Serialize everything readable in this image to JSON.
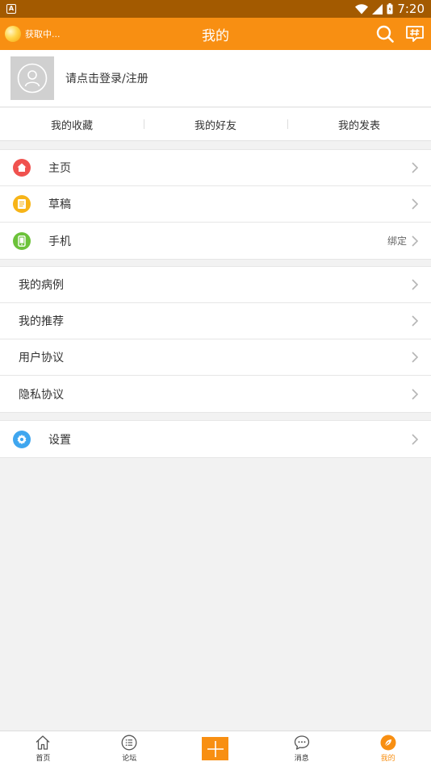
{
  "status_bar": {
    "app_badge": "A",
    "time": "7:20"
  },
  "header": {
    "weather_text": "获取中...",
    "title": "我的"
  },
  "profile": {
    "login_text": "请点击登录/注册"
  },
  "quick_links": [
    {
      "label": "我的收藏"
    },
    {
      "label": "我的好友"
    },
    {
      "label": "我的发表"
    }
  ],
  "menu_primary": [
    {
      "label": "主页",
      "icon": "home-icon",
      "color": "#f0524f"
    },
    {
      "label": "草稿",
      "icon": "draft-icon",
      "color": "#f7b418"
    },
    {
      "label": "手机",
      "icon": "phone-icon",
      "color": "#6cc23a",
      "extra": "绑定"
    }
  ],
  "menu_secondary": [
    {
      "label": "我的病例"
    },
    {
      "label": "我的推荐"
    },
    {
      "label": "用户协议"
    },
    {
      "label": "隐私协议"
    }
  ],
  "menu_settings": [
    {
      "label": "设置",
      "icon": "gear-icon",
      "color": "#3fa6ef"
    }
  ],
  "tab_bar": [
    {
      "label": "首页",
      "icon": "home-outline-icon"
    },
    {
      "label": "论坛",
      "icon": "list-icon"
    },
    {
      "label": "",
      "icon": "plus-icon"
    },
    {
      "label": "消息",
      "icon": "chat-bubble-icon"
    },
    {
      "label": "我的",
      "icon": "profile-leaf-icon",
      "active": true
    }
  ],
  "colors": {
    "accent": "#f88f12",
    "status_bar": "#a35a00",
    "background": "#f2f2f2"
  }
}
